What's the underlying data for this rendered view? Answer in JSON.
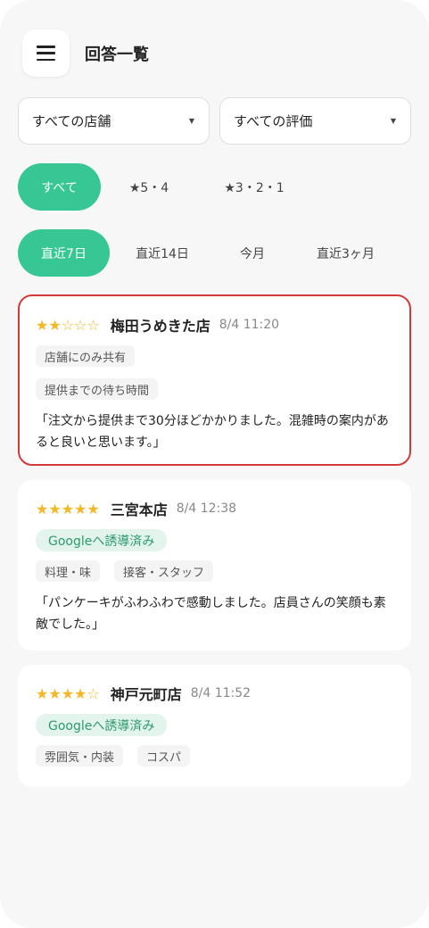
{
  "header": {
    "title": "回答一覧",
    "menu_icon": "hamburger-menu-icon"
  },
  "filters": {
    "store_select": "すべての店舗",
    "rating_select": "すべての評価",
    "rating_pills": [
      {
        "label": "すべて",
        "active": true
      },
      {
        "label": "★5・4",
        "active": false
      },
      {
        "label": "★3・2・1",
        "active": false
      }
    ],
    "period_pills": [
      {
        "label": "直近7日",
        "active": true
      },
      {
        "label": "直近14日",
        "active": false
      },
      {
        "label": "今月",
        "active": false
      },
      {
        "label": "直近3ヶ月",
        "active": false
      }
    ]
  },
  "responses": [
    {
      "rating": 2,
      "stars": "★★☆☆☆",
      "store": "梅田うめきた店",
      "time": "8/4 11:20",
      "tags": [
        "店舗にのみ共有",
        "提供までの待ち時間"
      ],
      "comment": "「注文から提供まで30分ほどかかりました。混雑時の案内があると良いと思います。」"
    },
    {
      "rating": 5,
      "stars": "★★★★★",
      "store": "三宮本店",
      "time": "8/4 12:38",
      "badge": "Googleへ誘導済み",
      "tags": [
        "料理・味",
        "接客・スタッフ"
      ],
      "comment": "「パンケーキがふわふわで感動しました。店員さんの笑顔も素敵でした。」"
    },
    {
      "rating": 4,
      "stars": "★★★★☆",
      "store": "神戸元町店",
      "time": "8/4 11:52",
      "badge": "Googleへ誘導済み",
      "tags": [
        "雰囲気・内装",
        "コスパ"
      ]
    }
  ],
  "colors": {
    "accent": "#36c795",
    "selected_border": "#d23a3a",
    "star": "#f3b823",
    "badge_text": "#2b9a6d"
  }
}
